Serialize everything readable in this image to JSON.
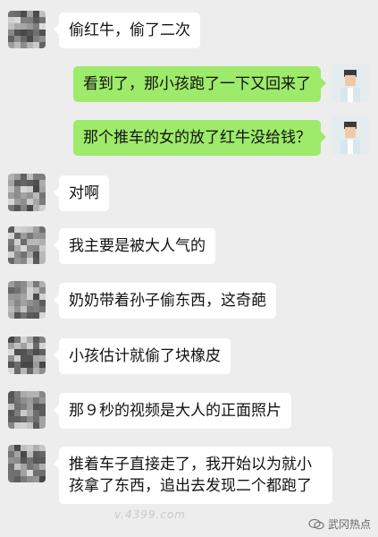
{
  "messages": [
    {
      "side": "left",
      "text": "偷红牛，偷了二次"
    },
    {
      "side": "right",
      "text": "看到了，那小孩跑了一下又回来了"
    },
    {
      "side": "right",
      "text": "那个推车的女的放了红牛没给钱？"
    },
    {
      "side": "left",
      "text": "对啊"
    },
    {
      "side": "left",
      "text": "我主要是被大人气的"
    },
    {
      "side": "left",
      "text": "奶奶带着孙子偷东西，这奇葩"
    },
    {
      "side": "left",
      "text": "小孩估计就偷了块橡皮"
    },
    {
      "side": "left",
      "text": "那９秒的视频是大人的正面照片"
    },
    {
      "side": "left",
      "text": "推着车子直接走了，我开始以为就小孩拿了东西，追出去发现二个都跑了"
    }
  ],
  "watermark": {
    "site": "v.4399.com",
    "brand": "武冈热点"
  },
  "colors": {
    "background": "#ededed",
    "bubble_self": "#9eea6a",
    "bubble_other": "#ffffff"
  },
  "icons": {
    "avatar_contact": "pixelated-avatar-icon",
    "avatar_self": "person-avatar-icon",
    "brand": "wechat-icon"
  }
}
